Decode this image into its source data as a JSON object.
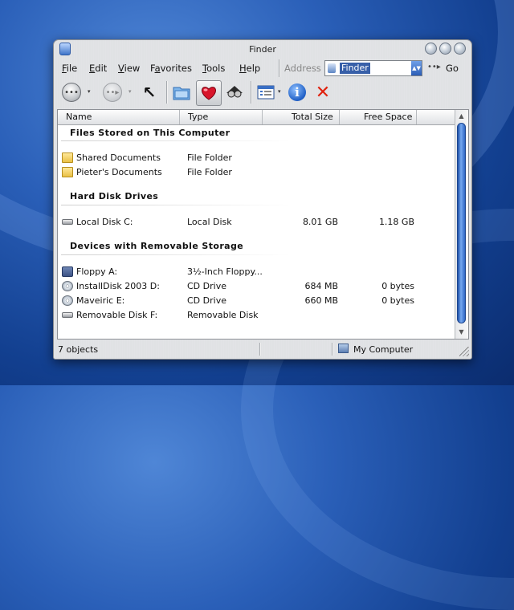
{
  "window": {
    "title": "Finder"
  },
  "menu": {
    "items": [
      {
        "accel": "F",
        "rest": "ile"
      },
      {
        "accel": "E",
        "rest": "dit"
      },
      {
        "accel": "V",
        "rest": "iew"
      },
      {
        "pre": "F",
        "accel": "a",
        "rest": "vorites"
      },
      {
        "accel": "T",
        "rest": "ools"
      },
      {
        "accel": "H",
        "rest": "elp"
      }
    ],
    "address_label": "Address",
    "address_value": "Finder",
    "go_arrow": "••▸",
    "go_label": "Go"
  },
  "toolbar": {
    "icons": [
      "back-icon",
      "forward-icon",
      "up-arrow-icon",
      "folders-icon",
      "favorites-heart-icon",
      "search-icon",
      "views-icon",
      "info-icon",
      "delete-icon"
    ],
    "back_glyph": "•••",
    "dropdown_glyph": "▾",
    "up_glyph": "↖",
    "delete_glyph": "✕",
    "info_glyph": "i"
  },
  "columns": [
    "Name",
    "Type",
    "Total Size",
    "Free Space"
  ],
  "groups": [
    {
      "title": "Files Stored on This Computer",
      "items": [
        {
          "name": "Shared Documents",
          "type": "File Folder",
          "total": "",
          "free": "",
          "icon": "folder-icon"
        },
        {
          "name": "Pieter's Documents",
          "type": "File Folder",
          "total": "",
          "free": "",
          "icon": "folder-icon"
        }
      ]
    },
    {
      "title": "Hard Disk Drives",
      "items": [
        {
          "name": "Local Disk C:",
          "type": "Local Disk",
          "total": "8.01 GB",
          "free": "1.18 GB",
          "icon": "hard-disk-icon"
        }
      ]
    },
    {
      "title": "Devices with Removable Storage",
      "items": [
        {
          "name": "Floppy A:",
          "type": "3½-Inch Floppy...",
          "total": "",
          "free": "",
          "icon": "floppy-icon"
        },
        {
          "name": "InstallDisk 2003 D:",
          "type": "CD Drive",
          "total": "684 MB",
          "free": "0 bytes",
          "icon": "cd-drive-icon"
        },
        {
          "name": "Maveiric E:",
          "type": "CD Drive",
          "total": "660 MB",
          "free": "0 bytes",
          "icon": "cd-drive-icon"
        },
        {
          "name": "Removable Disk F:",
          "type": "Removable Disk",
          "total": "",
          "free": "",
          "icon": "removable-disk-icon"
        }
      ]
    }
  ],
  "status": {
    "count": "7 objects",
    "zone": "My Computer"
  },
  "scroll": {
    "up": "▲",
    "down": "▼"
  }
}
